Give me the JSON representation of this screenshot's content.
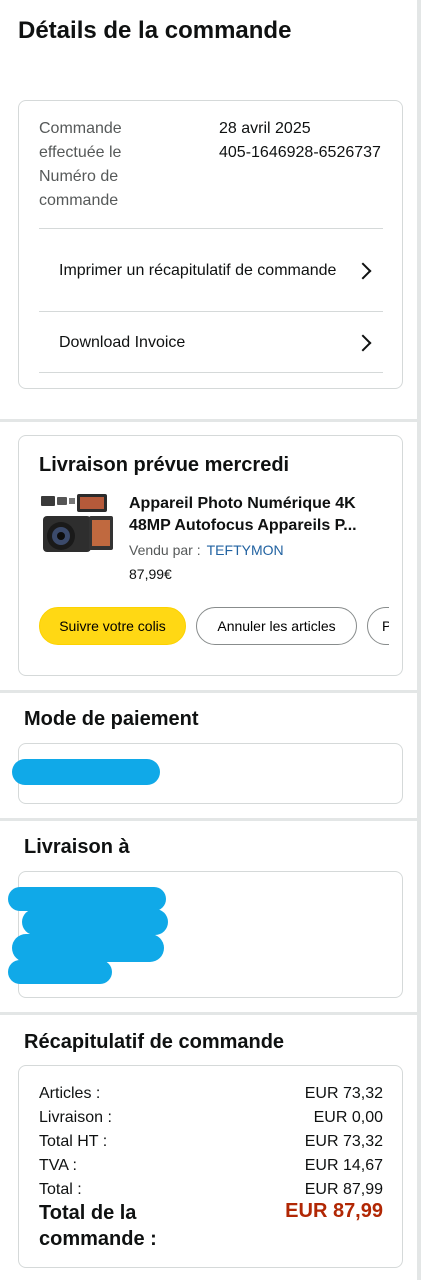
{
  "page_title": "Détails de la commande",
  "order_info": {
    "date_label": "Commande effectuée le",
    "date_value": "28 avril 2025",
    "number_label": "Numéro de commande",
    "number_value": "405-1646928-6526737",
    "links": [
      {
        "label": "Imprimer un récapitulatif de commande",
        "icon": "chevron-right-icon"
      },
      {
        "label": "Download Invoice",
        "icon": "chevron-right-icon"
      }
    ]
  },
  "delivery": {
    "title": "Livraison prévue mercredi",
    "product": {
      "name": "Appareil Photo Numérique 4K 48MP Autofocus Appareils P...",
      "name_line1": "Appareil Photo Numérique 4K",
      "name_line2": "48MP Autofocus Appareils P...",
      "sold_by_label": "Vendu par  :",
      "seller": "TEFTYMON",
      "price": "87,99€"
    },
    "buttons": {
      "track": "Suivre votre colis",
      "cancel": "Annuler les articles",
      "partial": "P"
    }
  },
  "payment": {
    "title": "Mode de paiement"
  },
  "shipping": {
    "title": "Livraison à"
  },
  "summary": {
    "title": "Récapitulatif de commande",
    "rows": [
      {
        "label": "Articles :",
        "value": "EUR 73,32"
      },
      {
        "label": "Livraison :",
        "value": "EUR 0,00"
      },
      {
        "label": "Total HT :",
        "value": "EUR 73,32"
      },
      {
        "label": "TVA :",
        "value": "EUR 14,67"
      },
      {
        "label": "Total :",
        "value": "EUR 87,99"
      }
    ],
    "grand_total_label": "Total de la commande :",
    "grand_total_value": "EUR 87,99"
  },
  "colors": {
    "accent_yellow": "#ffd814",
    "price_red": "#b12704",
    "link_blue": "#2162a1",
    "redaction_blue": "#10a9e8"
  }
}
